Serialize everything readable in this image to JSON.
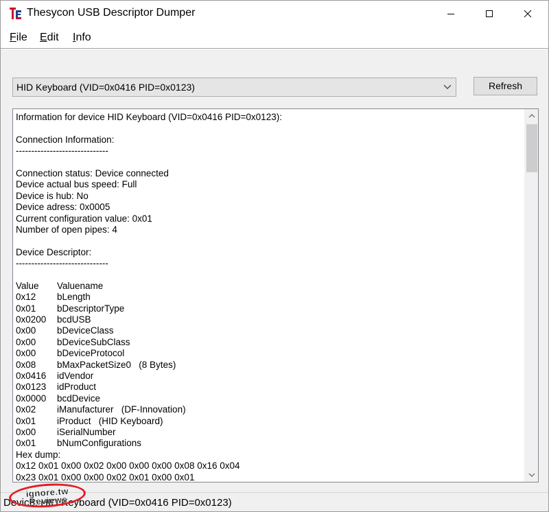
{
  "window": {
    "title": "Thesycon USB Descriptor Dumper",
    "icon": "usb-app-icon",
    "controls": [
      "minimize-icon",
      "maximize-icon",
      "close-icon"
    ]
  },
  "menu": {
    "file": {
      "mnemonic": "F",
      "rest": "ile"
    },
    "edit": {
      "mnemonic": "E",
      "rest": "dit"
    },
    "info": {
      "mnemonic": "I",
      "rest": "nfo"
    }
  },
  "toolbar": {
    "device_select": "HID Keyboard (VID=0x0416 PID=0x0123)",
    "refresh_label": "Refresh"
  },
  "output": {
    "lines": [
      "Information for device HID Keyboard (VID=0x0416 PID=0x0123):",
      "",
      "Connection Information:",
      "------------------------------",
      "",
      "Connection status: Device connected",
      "Device actual bus speed: Full",
      "Device is hub: No",
      "Device adress: 0x0005",
      "Current configuration value: 0x01",
      "Number of open pipes: 4",
      "",
      "Device Descriptor:",
      "------------------------------",
      ""
    ],
    "table": [
      [
        "Value",
        "Valuename"
      ],
      [
        "0x12",
        "bLength"
      ],
      [
        "0x01",
        "bDescriptorType"
      ],
      [
        "0x0200",
        "bcdUSB"
      ],
      [
        "0x00",
        "bDeviceClass"
      ],
      [
        "0x00",
        "bDeviceSubClass"
      ],
      [
        "0x00",
        "bDeviceProtocol"
      ],
      [
        "0x08",
        "bMaxPacketSize0   (8 Bytes)"
      ],
      [
        "0x0416",
        "idVendor"
      ],
      [
        "0x0123",
        "idProduct"
      ],
      [
        "0x0000",
        "bcdDevice"
      ],
      [
        "0x02",
        "iManufacturer   (DF-Innovation)"
      ],
      [
        "0x01",
        "iProduct   (HID Keyboard)"
      ],
      [
        "0x00",
        "iSerialNumber"
      ],
      [
        "0x01",
        "bNumConfigurations"
      ]
    ],
    "trailer": [
      "Hex dump:",
      "0x12 0x01 0x00 0x02 0x00 0x00 0x00 0x08 0x16 0x04",
      "0x23 0x01 0x00 0x00 0x02 0x01 0x00 0x01"
    ]
  },
  "status": {
    "text": "Device: HID Keyboard (VID=0x0416 PID=0x0123)"
  },
  "watermark": {
    "line1": "ignore.tw",
    "line2": "Reviews",
    "color": "#e41c23"
  },
  "colors": {
    "face": "#f0f0f0",
    "border": "#adadad",
    "scroll_thumb": "#cdcdcd"
  }
}
